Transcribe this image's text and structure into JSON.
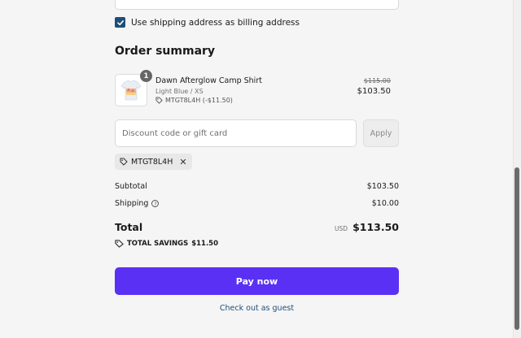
{
  "billing": {
    "checked": true,
    "label": "Use shipping address as billing address"
  },
  "order_summary": {
    "title": "Order summary",
    "item": {
      "quantity": "1",
      "name": "Dawn Afterglow Camp Shirt",
      "variant": "Light Blue / XS",
      "discount_code": "MTGT8L4H (-$11.50)",
      "original_price": "$115.00",
      "price": "$103.50"
    },
    "discount_input": {
      "placeholder": "Discount code or gift card",
      "value": ""
    },
    "apply_label": "Apply",
    "applied_code": "MTGT8L4H",
    "subtotal_label": "Subtotal",
    "subtotal_value": "$103.50",
    "shipping_label": "Shipping",
    "shipping_value": "$10.00",
    "total_label": "Total",
    "currency": "USD",
    "total_value": "$113.50",
    "savings_label": "TOTAL SAVINGS",
    "savings_value": "$11.50"
  },
  "actions": {
    "pay_label": "Pay now",
    "guest_label": "Check out as guest"
  },
  "colors": {
    "accent": "#5a31f4",
    "link": "#1f4e79",
    "checkbox": "#1f4e79"
  }
}
